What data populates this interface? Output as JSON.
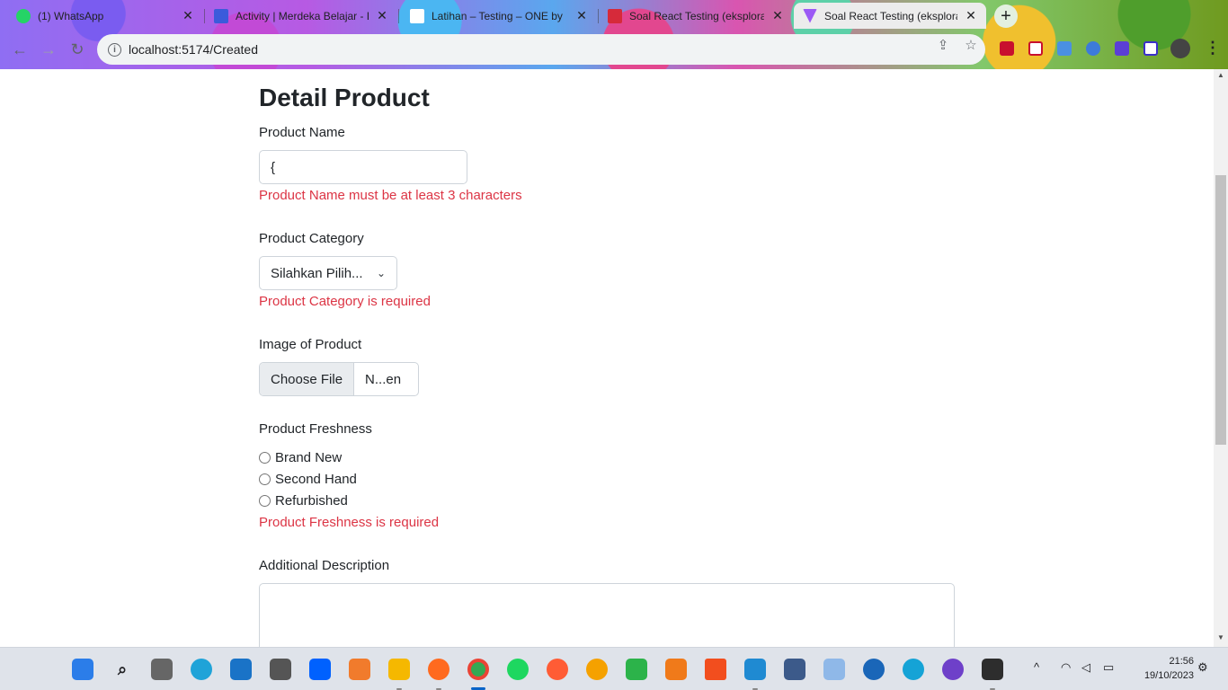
{
  "browser": {
    "tabs": [
      {
        "title": "(1) WhatsApp",
        "favicon_color": "#25d366"
      },
      {
        "title": "Activity | Merdeka Belajar - K",
        "favicon_color": "#3b5bdb"
      },
      {
        "title": "Latihan – Testing – ONE by",
        "favicon_color": "#ffffff"
      },
      {
        "title": "Soal React Testing (eksploras",
        "favicon_color": "#d62a3a"
      },
      {
        "title": "Soal React Testing (eksploras",
        "favicon_color": "#9b59f5"
      }
    ],
    "close_glyph": "✕",
    "new_tab_glyph": "+",
    "url": "localhost:5174/Created"
  },
  "form": {
    "title": "Detail Product",
    "product_name": {
      "label": "Product Name",
      "value": "{",
      "error": "Product Name must be at least 3 characters"
    },
    "product_category": {
      "label": "Product Category",
      "selected": "Silahkan Pilih...",
      "error": "Product Category is required"
    },
    "image": {
      "label": "Image of Product",
      "button": "Choose File",
      "file_name": "N...en"
    },
    "freshness": {
      "label": "Product Freshness",
      "options": [
        "Brand New",
        "Second Hand",
        "Refurbished"
      ],
      "error": "Product Freshness is required"
    },
    "description": {
      "label": "Additional Description",
      "value": ""
    }
  },
  "taskbar": {
    "time": "21:56",
    "date": "19/10/2023"
  },
  "colors": {
    "error": "#dc3545",
    "text": "#212529",
    "border": "#ced4da"
  }
}
